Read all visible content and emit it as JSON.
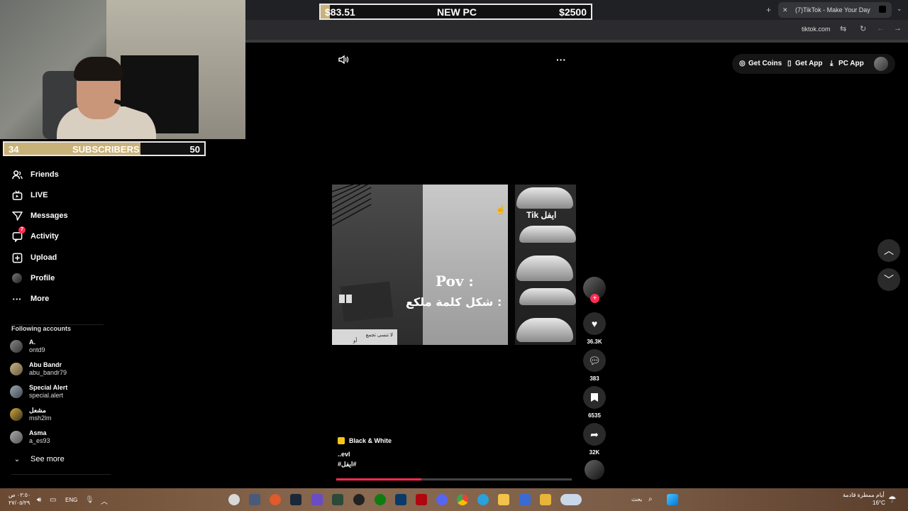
{
  "overlay": {
    "subscribers_current": "34",
    "subscribers_label": "SUBSCRIBERS",
    "subscribers_goal": "50",
    "subscribers_progress": 0.68,
    "pc_current": "$83.51",
    "pc_label": "NEW PC",
    "pc_goal": "$2500",
    "pc_progress": 0.034
  },
  "browser": {
    "tab_title": "(7)TikTok - Make Your Day",
    "url": "tiktok.com"
  },
  "sidebar": {
    "items": [
      {
        "label": "Friends",
        "icon": "friends-icon"
      },
      {
        "label": "LIVE",
        "icon": "live-icon"
      },
      {
        "label": "Messages",
        "icon": "messages-icon"
      },
      {
        "label": "Activity",
        "icon": "activity-icon",
        "badge": "7"
      },
      {
        "label": "Upload",
        "icon": "upload-icon"
      },
      {
        "label": "Profile",
        "icon": "profile-icon"
      },
      {
        "label": "More",
        "icon": "more-icon"
      }
    ],
    "following_header": "Following accounts",
    "accounts": [
      {
        "name": "A.",
        "handle": "ontd9"
      },
      {
        "name": "Abu Bandr",
        "handle": "abu_bandr79"
      },
      {
        "name": "Special Alert",
        "handle": "special.alert"
      },
      {
        "name": "مشعل",
        "handle": "msh2lm"
      },
      {
        "name": "Asma",
        "handle": "a_es93"
      }
    ],
    "see_more": "See more"
  },
  "topbar": {
    "get_coins": "Get Coins",
    "get_app": "Get App",
    "pc_app": "PC App"
  },
  "video": {
    "overlay_title": "Pov :",
    "overlay_arabic": "شكل كلمة ملكع :",
    "watermark": "Tik ايفل",
    "strip_text": "لا تنسى تجمع",
    "strip_text2": "أو",
    "music": "Black & White",
    "caption": "..evl",
    "hashtag": "#ايفل#",
    "progress": 0.36
  },
  "actions": {
    "likes": "36.3K",
    "comments": "383",
    "saves": "6535",
    "shares": "32K"
  },
  "taskbar": {
    "time": "٠٢:٥٠ ص",
    "date": "٢٧/٠٥/٢٩",
    "lang": "ENG",
    "search_label": "بحث",
    "weather_text": "أيام ممطرة قادمة",
    "temperature": "16°C"
  },
  "colors": {
    "accent": "#fe2c55",
    "goal_fill": "#c9b27a"
  }
}
